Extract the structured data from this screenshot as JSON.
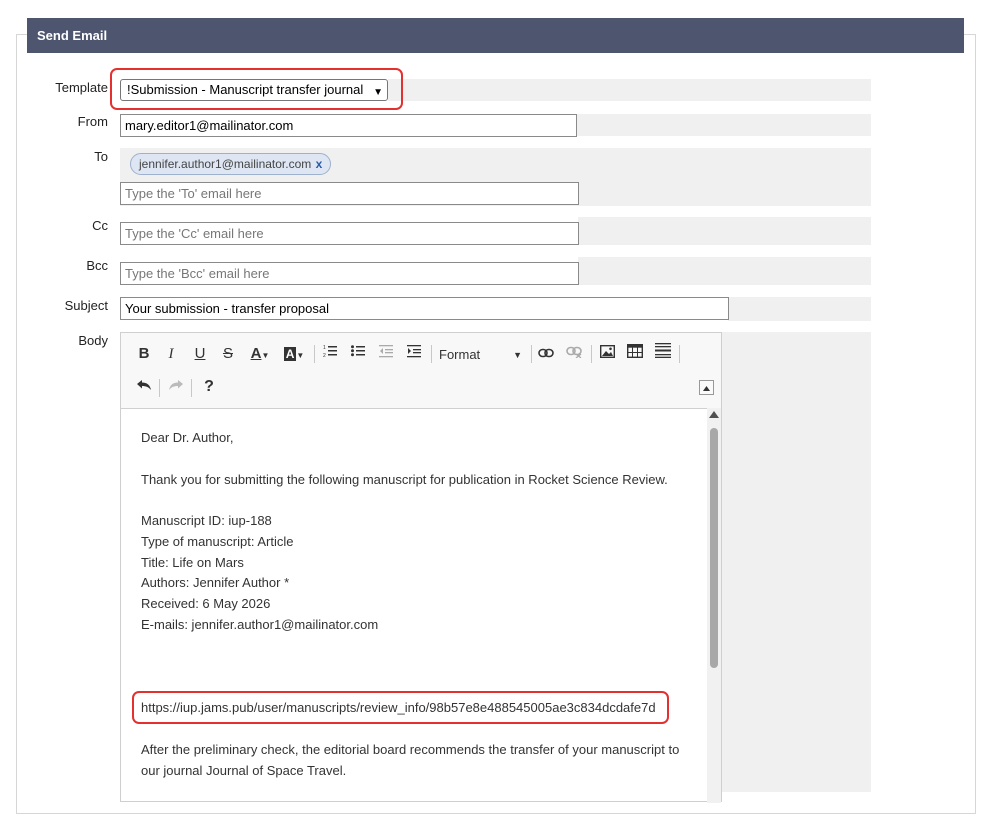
{
  "header": {
    "title": "Send Email"
  },
  "form": {
    "template_label": "Template",
    "template_value": "!Submission - Manuscript transfer journal",
    "from_label": "From",
    "from_value": "mary.editor1@mailinator.com",
    "to_label": "To",
    "to_chip": "jennifer.author1@mailinator.com",
    "to_chip_remove": "x",
    "to_placeholder": "Type the 'To' email here",
    "cc_label": "Cc",
    "cc_placeholder": "Type the 'Cc' email here",
    "bcc_label": "Bcc",
    "bcc_placeholder": "Type the 'Bcc' email here",
    "subject_label": "Subject",
    "subject_value": "Your submission - transfer proposal",
    "body_label": "Body"
  },
  "toolbar": {
    "bold": "B",
    "italic": "I",
    "underline": "U",
    "strike": "S",
    "format_label": "Format",
    "help": "?"
  },
  "body": {
    "greeting": "Dear Dr. Author,",
    "thanks": "Thank you for submitting the following manuscript for publication in Rocket Science Review.",
    "manuscript_id": "Manuscript ID: iup-188",
    "type": "Type of manuscript: Article",
    "title": "Title: Life on Mars",
    "authors": "Authors: Jennifer Author *",
    "received": "Received: 6 May 2026",
    "emails": "E-mails: jennifer.author1@mailinator.com",
    "link": "https://iup.jams.pub/user/manuscripts/review_info/98b57e8e488545005ae3c834dcdafe7d",
    "after1": "After the preliminary check, the editorial board recommends the transfer of your manuscript to",
    "after2": "our journal Journal of Space Travel."
  },
  "colors": {
    "header_bg": "#4e566f",
    "highlight": "#e53030",
    "chip_bg": "#dde6f2"
  }
}
